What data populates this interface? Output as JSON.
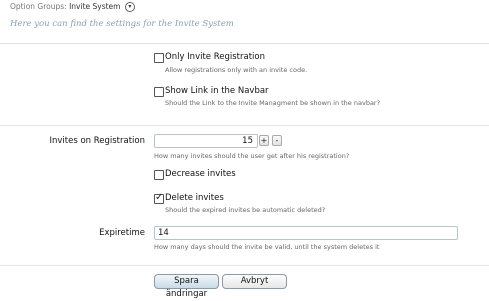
{
  "breadcrumb": {
    "prefix": "Option Groups:",
    "current": "Invite System"
  },
  "page_description": "Here you can find the settings for the Invite System",
  "options": {
    "only_invite": {
      "label": "Only Invite Registration",
      "hint": "Allow registrations only with an invite code.",
      "checked": false
    },
    "show_link": {
      "label": "Show Link in the Navbar",
      "hint": "Should the Link to the Invite Managment be shown in the navbar?",
      "checked": false
    },
    "invites_on_registration": {
      "label": "Invites on Registration",
      "value": "15",
      "plus": "+",
      "minus": "-",
      "hint": "How many invites should the user get after his registration?"
    },
    "decrease_invites": {
      "label": "Decrease invites",
      "checked": false
    },
    "delete_invites": {
      "label": "Delete invites",
      "hint": "Should the expired invites be automatic deleted?",
      "checked": true
    },
    "expiretime": {
      "label": "Expiretime",
      "value": "14",
      "hint": "How many days should the invite be valid, until the system deletes it"
    }
  },
  "buttons": {
    "save": "Spara ändringar",
    "cancel": "Avbryt"
  }
}
